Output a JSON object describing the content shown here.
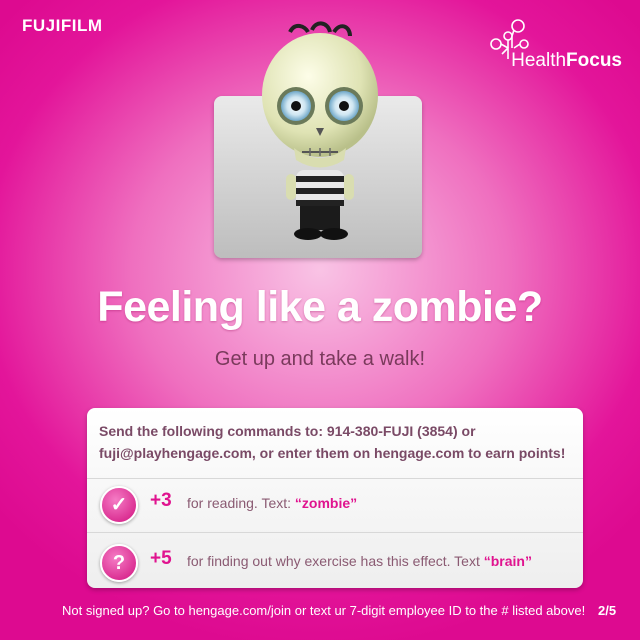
{
  "brand": {
    "fujifilm": "FUJIFILM"
  },
  "health_focus": {
    "word1": "Health",
    "word2": "Focus"
  },
  "headline": "Feeling like a zombie?",
  "subline": "Get up and take a walk!",
  "panel": {
    "intro": "Send the following commands to: 914-380-FUJI (3854) or fuji@playhengage.com, or enter them on hengage.com to earn points!",
    "items": [
      {
        "icon": "checkmark-icon",
        "points": "+3",
        "text": "for reading. Text: ",
        "keyword": "“zombie”"
      },
      {
        "icon": "question-icon",
        "points": "+5",
        "text": "for finding out why exercise has this effect. Text ",
        "keyword": "“brain”"
      }
    ]
  },
  "footer": "Not signed up? Go to hengage.com/join or text ur 7-digit employee ID to the # listed above!",
  "page_indicator": "2/5",
  "colors": {
    "accent": "#e0138f",
    "background": "#e3159a"
  }
}
